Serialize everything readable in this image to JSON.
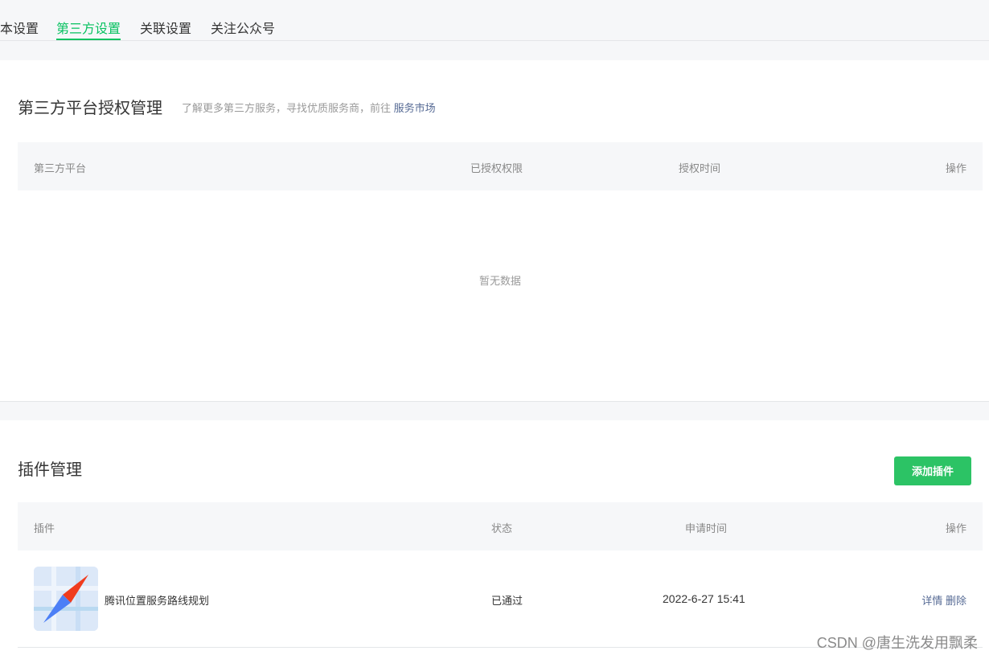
{
  "tabs": [
    {
      "label": "本设置",
      "active": false
    },
    {
      "label": "第三方设置",
      "active": true
    },
    {
      "label": "关联设置",
      "active": false
    },
    {
      "label": "关注公众号",
      "active": false
    }
  ],
  "auth_section": {
    "title": "第三方平台授权管理",
    "desc": "了解更多第三方服务，寻找优质服务商，前往",
    "link": "服务市场",
    "columns": [
      "第三方平台",
      "已授权权限",
      "授权时间",
      "操作"
    ],
    "empty_text": "暂无数据"
  },
  "plugin_section": {
    "title": "插件管理",
    "add_button": "添加插件",
    "columns": [
      "插件",
      "状态",
      "申请时间",
      "操作"
    ],
    "rows": [
      {
        "icon": "map-compass-icon",
        "name": "腾讯位置服务路线规划",
        "status": "已通过",
        "time": "2022-6-27 15:41",
        "actions": [
          "详情",
          "删除"
        ]
      }
    ]
  },
  "watermark": "CSDN @唐生洗发用飘柔",
  "colors": {
    "accent": "#07c160",
    "button": "#2cc365",
    "link": "#576b95"
  }
}
